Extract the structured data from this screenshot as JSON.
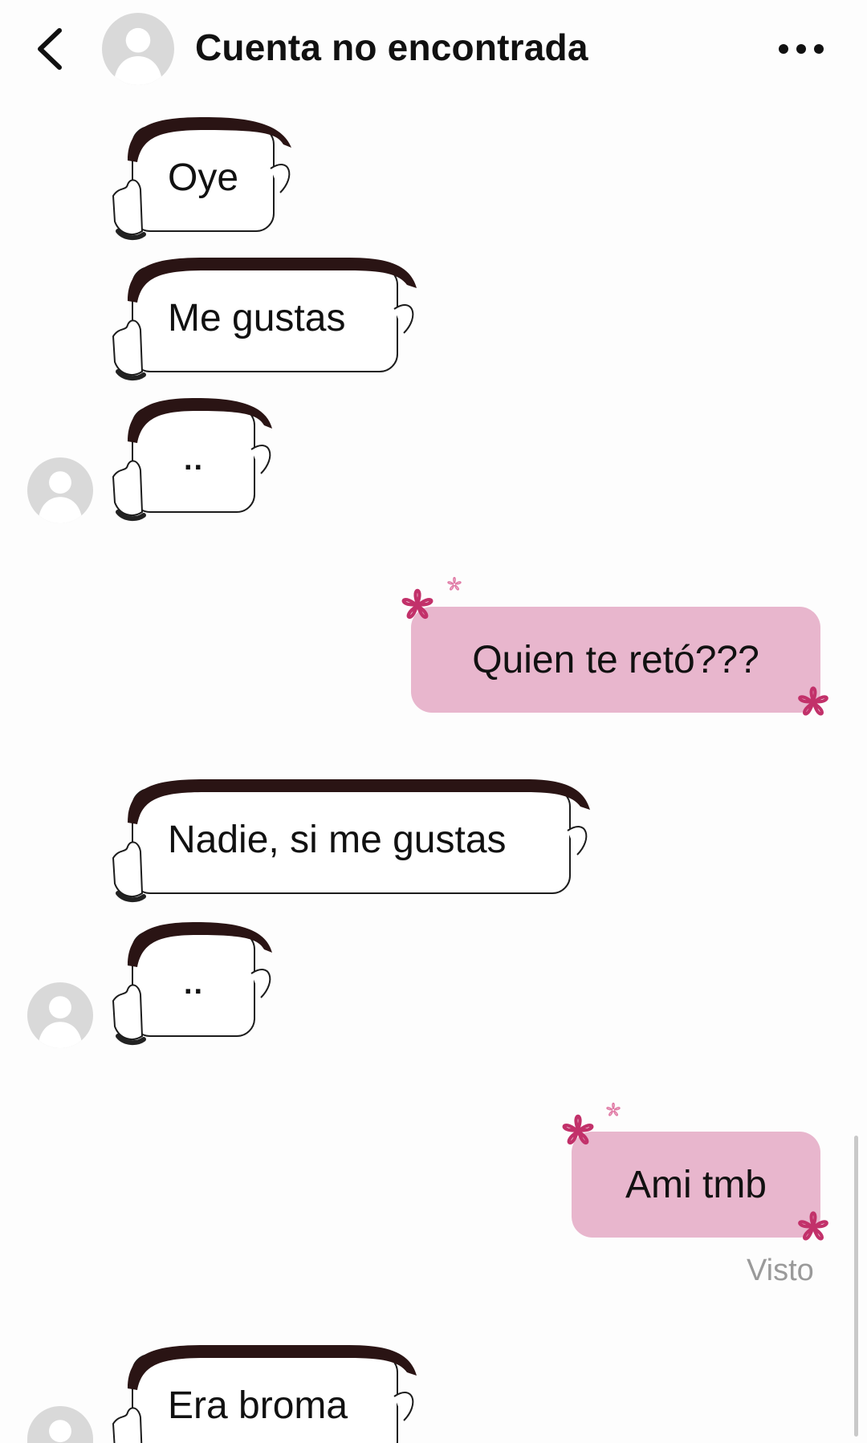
{
  "header": {
    "title": "Cuenta no encontrada",
    "back_icon": "chevron-left-icon",
    "more_icon": "more-horizontal-icon",
    "avatar_icon": "default-avatar-icon"
  },
  "messages": [
    {
      "from": "them",
      "text": "Oye"
    },
    {
      "from": "them",
      "text": "Me gustas"
    },
    {
      "from": "them",
      "text": ".."
    },
    {
      "from": "me",
      "text": "Quien te retó???"
    },
    {
      "from": "them",
      "text": "Nadie, si me gustas"
    },
    {
      "from": "them",
      "text": ".."
    },
    {
      "from": "me",
      "text": "Ami tmb"
    },
    {
      "from": "them",
      "text": "Era broma"
    }
  ],
  "seen_status": "Visto",
  "colors": {
    "outgoing_bubble": "#e8b6cd",
    "flower": "#c2316a",
    "hair": "#2a1414",
    "background": "#fdfdfd"
  }
}
